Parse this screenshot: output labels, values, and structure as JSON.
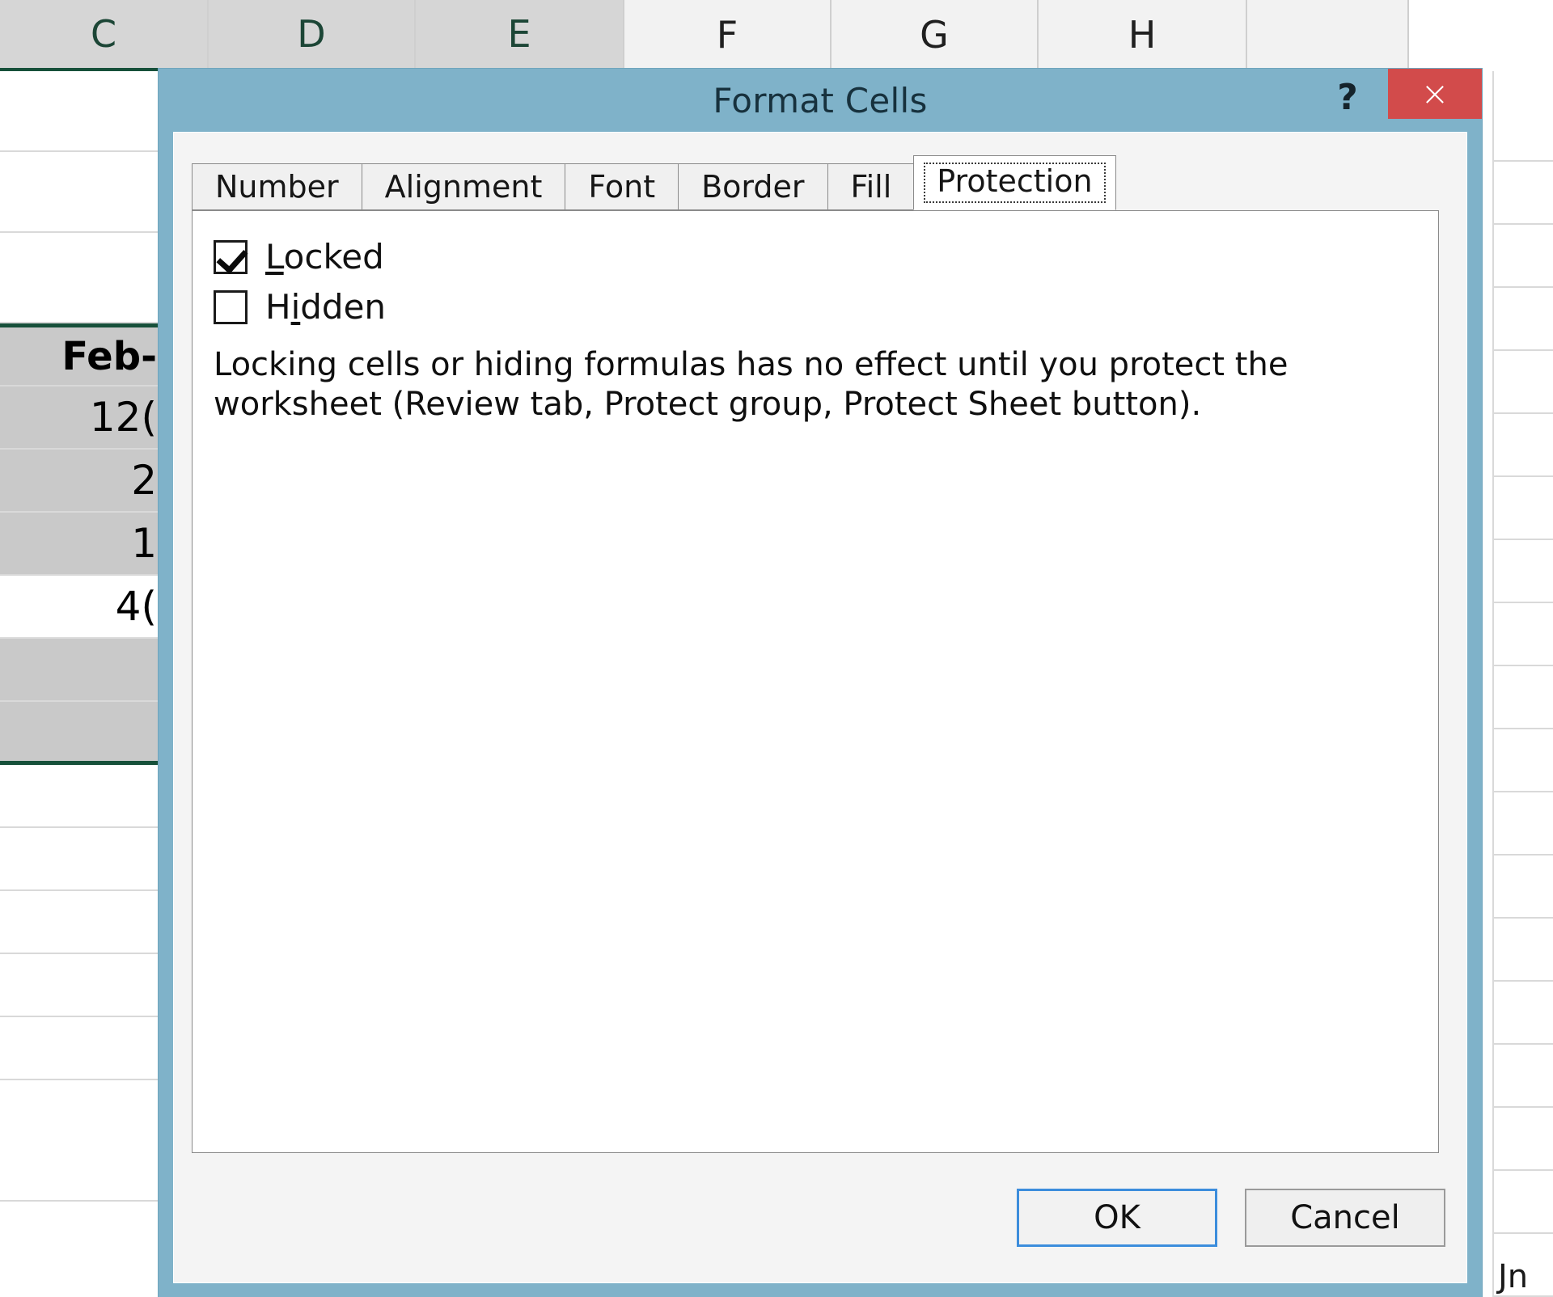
{
  "spreadsheet": {
    "column_headers": [
      {
        "label": "C",
        "selected": true
      },
      {
        "label": "D",
        "selected": true
      },
      {
        "label": "E",
        "selected": true
      },
      {
        "label": "F",
        "selected": false
      },
      {
        "label": "G",
        "selected": false
      },
      {
        "label": "H",
        "selected": false
      }
    ],
    "visible_cells": [
      {
        "value": "",
        "selected": false
      },
      {
        "value": "",
        "selected": false
      },
      {
        "value": "",
        "selected": false
      },
      {
        "value": "Feb-",
        "selected": true,
        "bold": true
      },
      {
        "value": "12(",
        "selected": true
      },
      {
        "value": "2",
        "selected": true
      },
      {
        "value": "1",
        "selected": true
      },
      {
        "value": "4(",
        "selected": false
      },
      {
        "value": "",
        "selected": true
      },
      {
        "value": "",
        "selected": true
      },
      {
        "value": "",
        "selected": false
      },
      {
        "value": "",
        "selected": false
      },
      {
        "value": "",
        "selected": false
      },
      {
        "value": "",
        "selected": false
      },
      {
        "value": "",
        "selected": false
      },
      {
        "value": "",
        "selected": false
      }
    ],
    "corner_fragment": "Jn",
    "selection_border_color": "#17503a",
    "selected_header_fill": "#d6d6d6"
  },
  "dialog": {
    "title": "Format Cells",
    "help_label": "?",
    "close_label": "×",
    "titlebar_color": "#7fb2c9",
    "close_button_color": "#d24b4b",
    "tabs": [
      {
        "label": "Number",
        "active": false
      },
      {
        "label": "Alignment",
        "active": false
      },
      {
        "label": "Font",
        "active": false
      },
      {
        "label": "Border",
        "active": false
      },
      {
        "label": "Fill",
        "active": false
      },
      {
        "label": "Protection",
        "active": true
      }
    ],
    "protection": {
      "locked": {
        "label_prefix": "",
        "accel": "L",
        "label_suffix": "ocked",
        "checked": true
      },
      "hidden": {
        "label_prefix": "H",
        "accel": "i",
        "label_suffix": "dden",
        "checked": false
      },
      "description": "Locking cells or hiding formulas has no effect until you protect the worksheet (Review tab, Protect group, Protect Sheet button)."
    },
    "buttons": {
      "ok": "OK",
      "cancel": "Cancel",
      "ok_focus_color": "#3c8ddc"
    }
  }
}
